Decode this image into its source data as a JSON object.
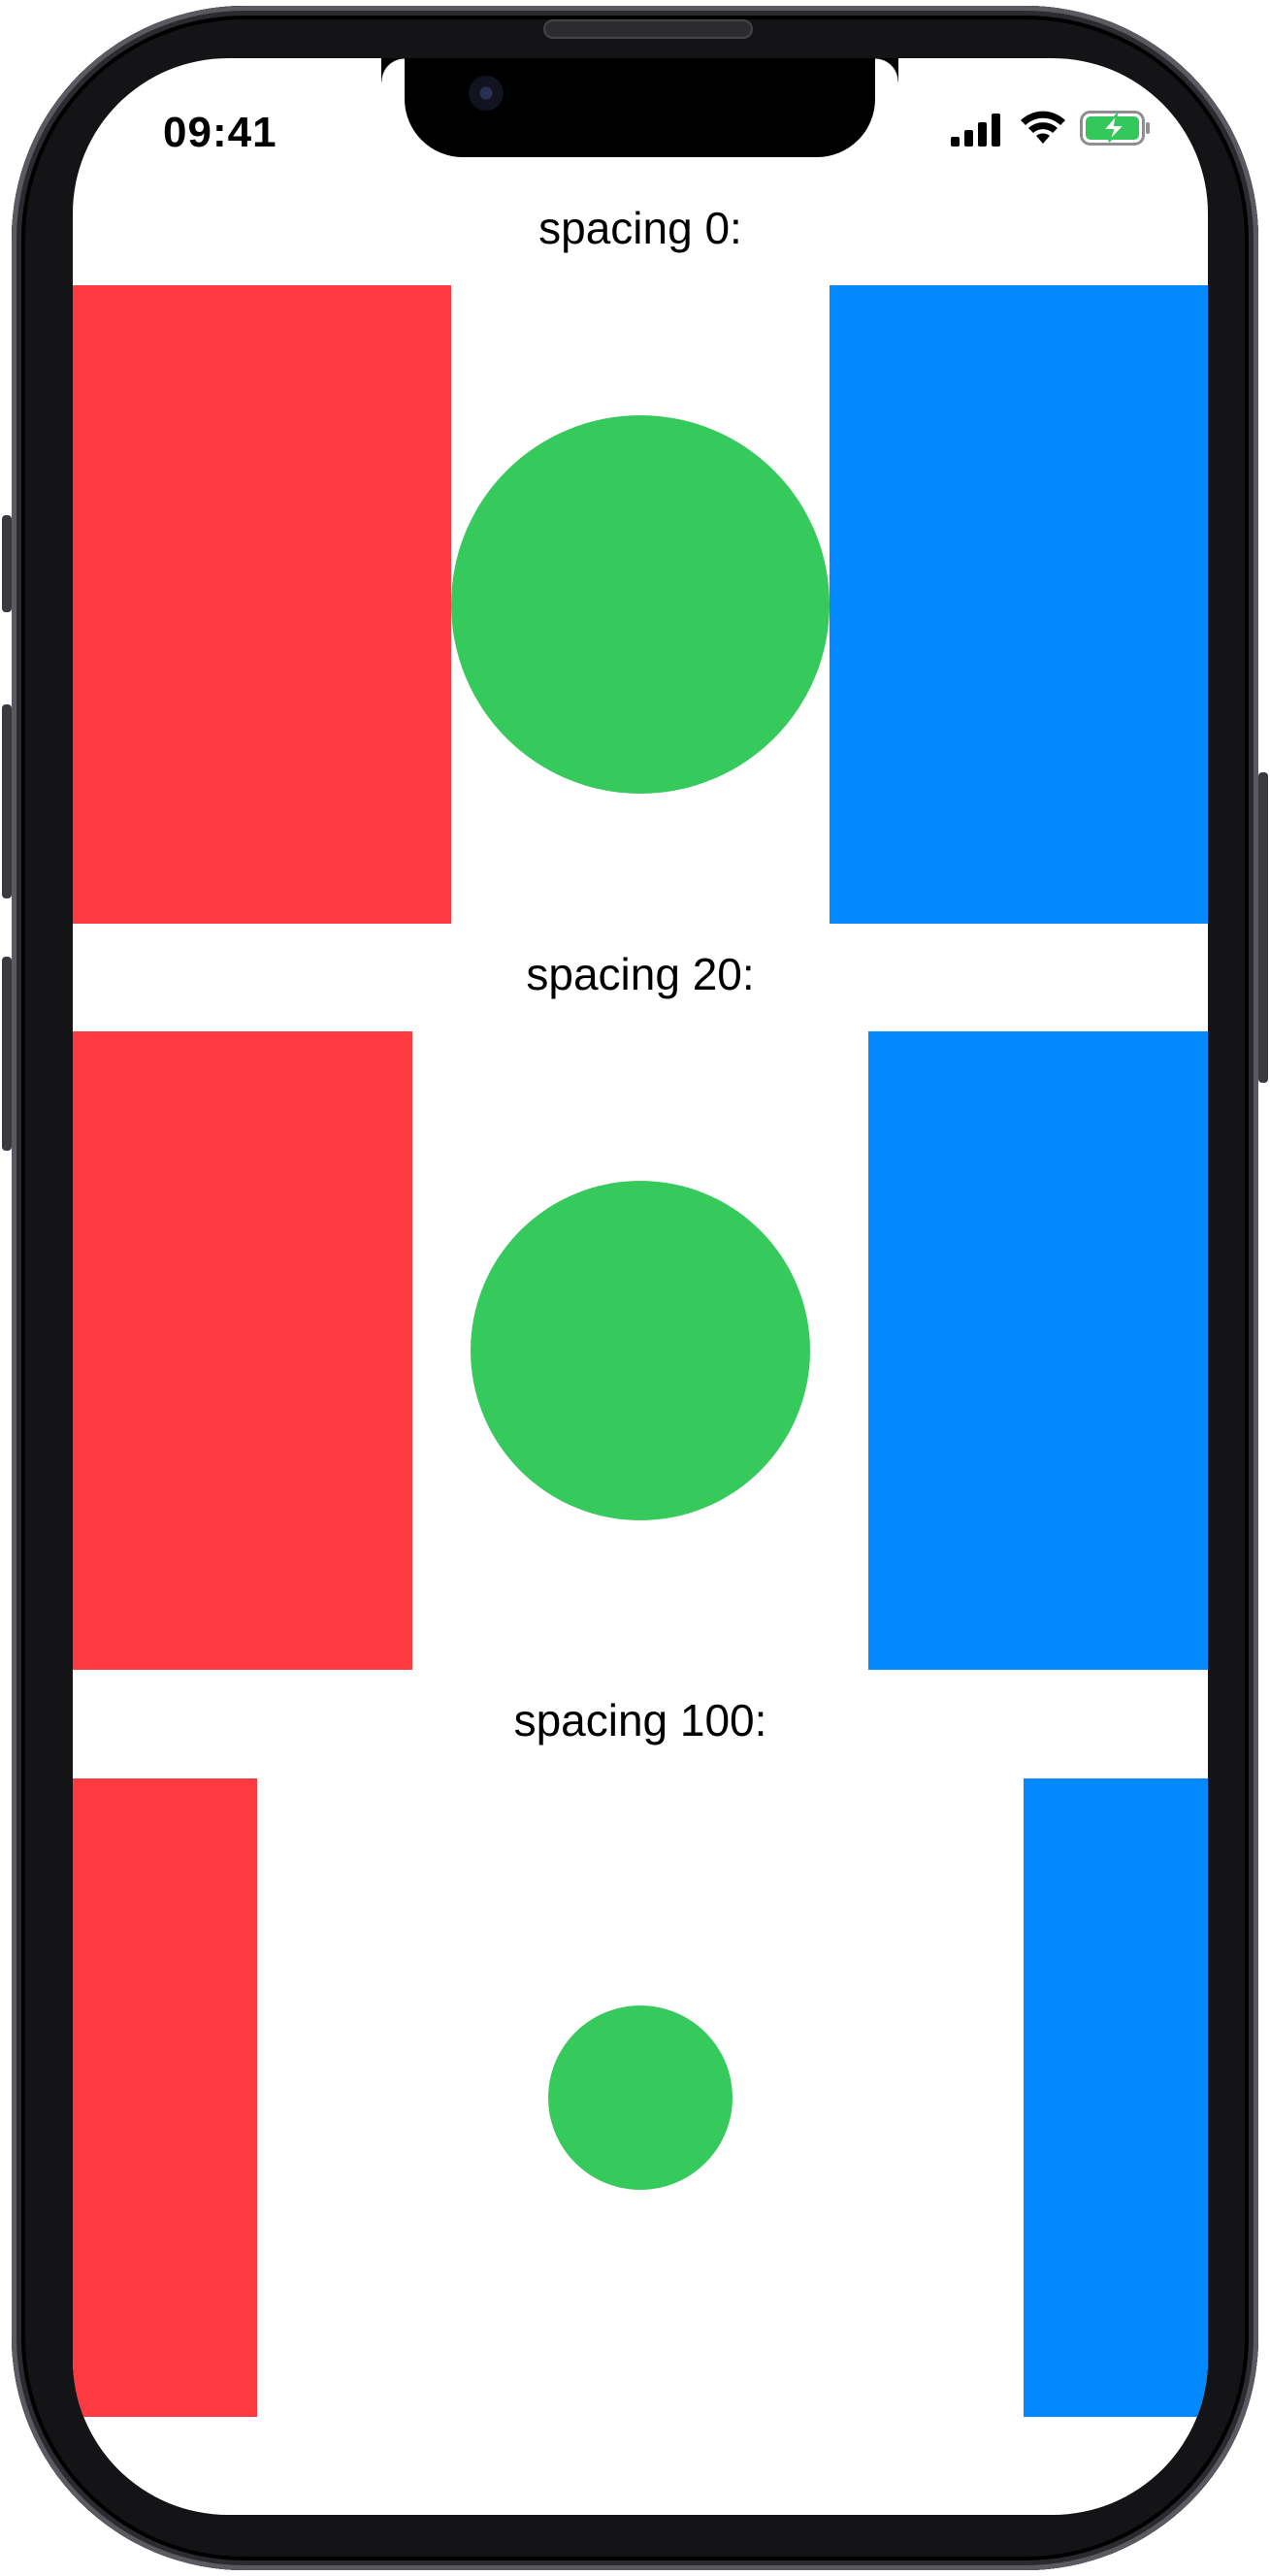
{
  "status_bar": {
    "time": "09:41",
    "signal_icon": "cellular-signal-icon",
    "wifi_icon": "wifi-icon",
    "battery_icon": "battery-charging-icon"
  },
  "colors": {
    "red": "#fc3a3f",
    "green": "#36c95c",
    "blue": "#0289ff",
    "battery_green": "#34c759"
  },
  "sections": [
    {
      "label": "spacing 0:"
    },
    {
      "label": "spacing 20:"
    },
    {
      "label": "spacing 100:"
    }
  ]
}
